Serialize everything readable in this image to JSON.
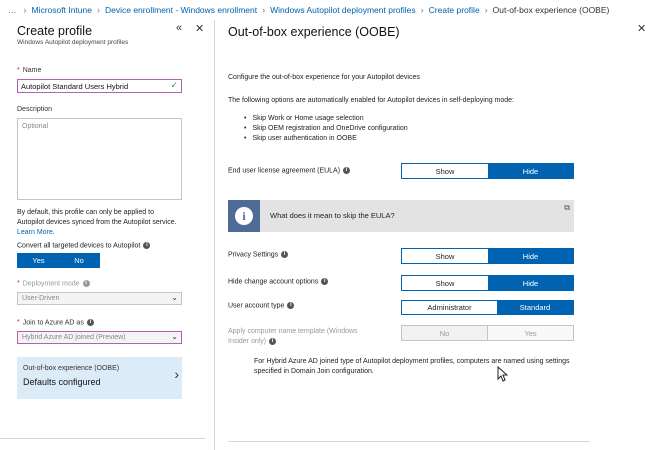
{
  "breadcrumb": {
    "ellipsis": "…",
    "items": [
      "Microsoft Intune",
      "Device enrollment - Windows enrollment",
      "Windows Autopilot deployment profiles",
      "Create profile"
    ],
    "current": "Out-of-box experience (OOBE)"
  },
  "left": {
    "title": "Create profile",
    "subtitle": "Windows Autopilot deployment profiles",
    "collapse_icon": "«",
    "close_icon": "✕",
    "name_label": "Name",
    "name_value": "Autopilot Standard Users Hybrid",
    "description_label": "Description",
    "description_placeholder": "Optional",
    "info_text": "By default, this profile can only be applied to Autopilot devices synced from the Autopilot service.",
    "learn_more": "Learn More.",
    "convert_label": "Convert all targeted devices to Autopilot",
    "convert_yes": "Yes",
    "convert_no": "No",
    "deployment_mode_label": "Deployment mode",
    "deployment_mode_value": "User-Driven",
    "join_label": "Join to Azure AD as",
    "join_value": "Hybrid Azure AD joined (Preview)",
    "oobe_title": "Out-of-box experience (OOBE)",
    "oobe_value": "Defaults configured"
  },
  "right": {
    "title": "Out-of-box experience (OOBE)",
    "close_icon": "✕",
    "intro": "Configure the out-of-box experience for your Autopilot devices",
    "auto_enabled": "The following options are automatically enabled for Autopilot devices in self-deploying mode:",
    "bullets": [
      "Skip Work or Home usage selection",
      "Skip OEM registration and OneDrive configuration",
      "Skip user authentication in OOBE"
    ],
    "eula_label": "End user license agreement (EULA)",
    "eula_banner": "What does it mean to skip the EULA?",
    "privacy_label": "Privacy Settings",
    "hide_change_label": "Hide change account options",
    "user_account_label": "User account type",
    "computer_name_label_1": "Apply computer name template (Windows",
    "computer_name_label_2": "Insider only)",
    "show": "Show",
    "hide": "Hide",
    "administrator": "Administrator",
    "standard": "Standard",
    "no": "No",
    "yes": "Yes",
    "note": "For Hybrid Azure AD joined type of Autopilot deployment profiles, computers are named using settings specified in Domain Join configuration."
  },
  "colors": {
    "accent": "#0063b1",
    "selected_item_bg": "#dcebf8",
    "required": "#c4261c",
    "focus_border": "#b061b4"
  }
}
